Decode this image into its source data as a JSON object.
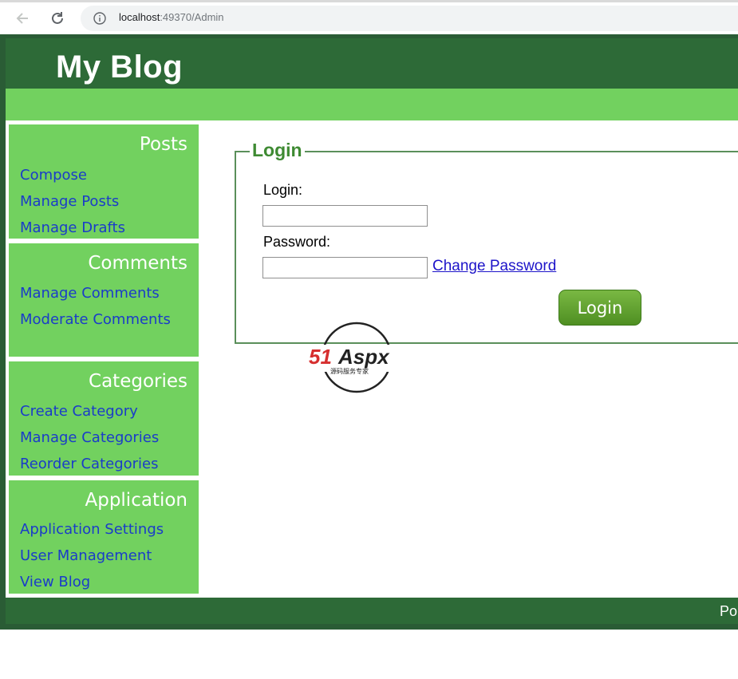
{
  "browser": {
    "url_host": "localhost",
    "url_rest": ":49370/Admin"
  },
  "header": {
    "title": "My Blog"
  },
  "sidebar": {
    "sections": [
      {
        "title": "Posts",
        "links": [
          "Compose",
          "Manage Posts",
          "Manage Drafts"
        ]
      },
      {
        "title": "Comments",
        "links": [
          "Manage Comments",
          "Moderate Comments"
        ]
      },
      {
        "title": "Categories",
        "links": [
          "Create Category",
          "Manage Categories",
          "Reorder Categories"
        ]
      },
      {
        "title": "Application",
        "links": [
          "Application Settings",
          "User Management",
          "View Blog"
        ]
      }
    ]
  },
  "login": {
    "legend": "Login",
    "login_label": "Login:",
    "password_label": "Password:",
    "login_value": "",
    "password_value": "",
    "change_password": "Change Password",
    "submit": "Login"
  },
  "watermark": {
    "brand": "51Aspx",
    "slogan": "源码服务专家"
  },
  "footer": {
    "text": "Po"
  },
  "colors": {
    "header_dark": "#2d6a37",
    "nav_light_green": "#72d15f",
    "link_blue": "#1a3cc9",
    "legend_green": "#3e8a32"
  }
}
